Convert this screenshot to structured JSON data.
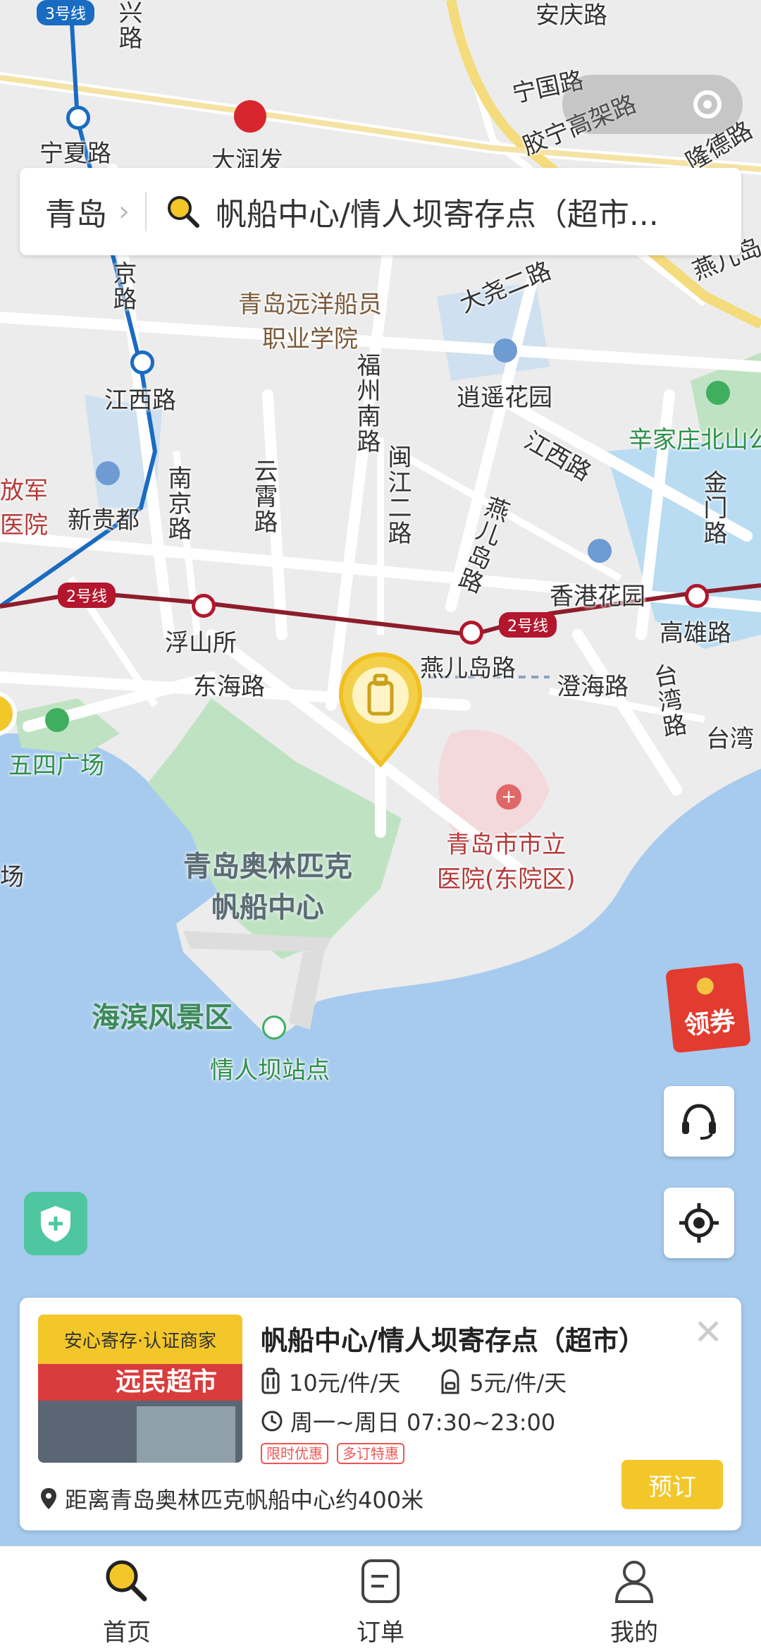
{
  "search": {
    "city": "青岛",
    "query": "帆船中心/情人坝寄存点（超市..."
  },
  "map": {
    "line_tags": {
      "line3": "3号线",
      "line2_a": "2号线",
      "line2_b": "2号线"
    },
    "labels": {
      "anqing_road": "安庆路",
      "xing_road": "兴路",
      "ningguo_road": "宁国路",
      "jiaoning_viaduct": "胶宁高架路",
      "longde_road": "隆德路",
      "ningxia_road": "宁夏路",
      "darunfa": "大润发",
      "ocean_college": "青岛远洋船员\n职业学院",
      "dayao_road": "大尧二路",
      "yanerdao_vertical": "燕儿岛",
      "jingkou_road": "京路",
      "jiangxi_road_station": "江西路",
      "fuzhou_south_road": "福州南路",
      "xiaoyao_garden": "逍遥花园",
      "xinjiazhuang": "辛家庄北山公",
      "jiangxi_road": "江西路",
      "army_hospital": "放军\n医院",
      "xinguidu": "新贵都",
      "nanjing_road": "南京路",
      "yunxiao_road": "云霄路",
      "minjiang_road": "闽江二路",
      "yanerdao_road_vert": "燕儿岛路",
      "jinmen_road": "金门路",
      "hongkong_garden": "香港花园",
      "fushansuo": "浮山所",
      "yanerdao_road_station": "燕儿岛路",
      "gaoxiong_road": "高雄路",
      "donghai_road": "东海路",
      "chenghai_road": "澄海路",
      "taiwan_road": "台湾路",
      "taiwan_partial": "台湾",
      "wusi_square": "五四广场",
      "municipal_hospital": "青岛市市立\n医院(东院区)",
      "olympic_sailing": "青岛奥林匹克\n帆船中心",
      "seaside_scenic": "海滨风景区",
      "qingrenba_station": "情人坝站点",
      "chang_partial": "场"
    }
  },
  "buttons": {
    "coupon": "领券"
  },
  "card": {
    "badge": "安心寄存·认证商家",
    "photo_sign": "远民超市",
    "title": "帆船中心/情人坝寄存点（超市）",
    "price_luggage": "10元/件/天",
    "price_bag": "5元/件/天",
    "hours": "周一~周日 07:30~23:00",
    "tags": [
      "限时优惠",
      "多订特惠"
    ],
    "distance": "距离青岛奥林匹克帆船中心约400米",
    "book": "预订",
    "close": "✕"
  },
  "tabs": [
    {
      "label": "首页",
      "icon": "search-icon"
    },
    {
      "label": "订单",
      "icon": "order-icon"
    },
    {
      "label": "我的",
      "icon": "profile-icon"
    }
  ],
  "colors": {
    "accent": "#f3c72a",
    "metro_line2": "#b3162d",
    "metro_line3": "#1a6bc2",
    "water": "#a7cbee",
    "park": "#bfe3c2"
  }
}
